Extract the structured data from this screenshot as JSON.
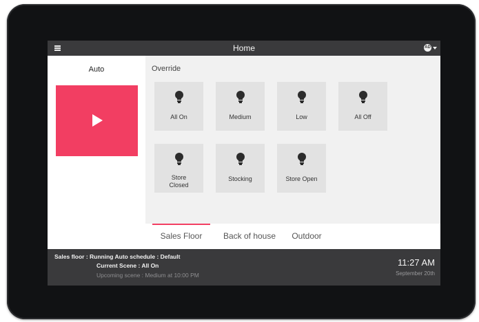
{
  "header": {
    "title": "Home",
    "user_initials": "AD"
  },
  "auto_panel": {
    "label": "Auto"
  },
  "override": {
    "label": "Override",
    "scenes": [
      {
        "label": "All On"
      },
      {
        "label": "Medium"
      },
      {
        "label": "Low"
      },
      {
        "label": "All Off"
      },
      {
        "label": "Store\nClosed"
      },
      {
        "label": "Stocking"
      },
      {
        "label": "Store Open"
      }
    ]
  },
  "tabs": [
    {
      "label": "Sales Floor",
      "active": true
    },
    {
      "label": "Back of house",
      "active": false
    },
    {
      "label": "Outdoor",
      "active": false
    }
  ],
  "status": {
    "line1": "Sales floor : Running Auto schedule : Default",
    "current_scene": "Current Scene : All On",
    "upcoming_scene": "Upcoming scene : Medium at 10:00 PM",
    "time": "11:27 AM",
    "date": "September 20th"
  },
  "colors": {
    "accent": "#f23e62",
    "bar": "#3a3a3c",
    "tile": "#e2e2e2"
  },
  "icons": {
    "scene_icon": "lightbulb-icon",
    "play": "play-icon",
    "menu": "hamburger-menu-icon"
  }
}
